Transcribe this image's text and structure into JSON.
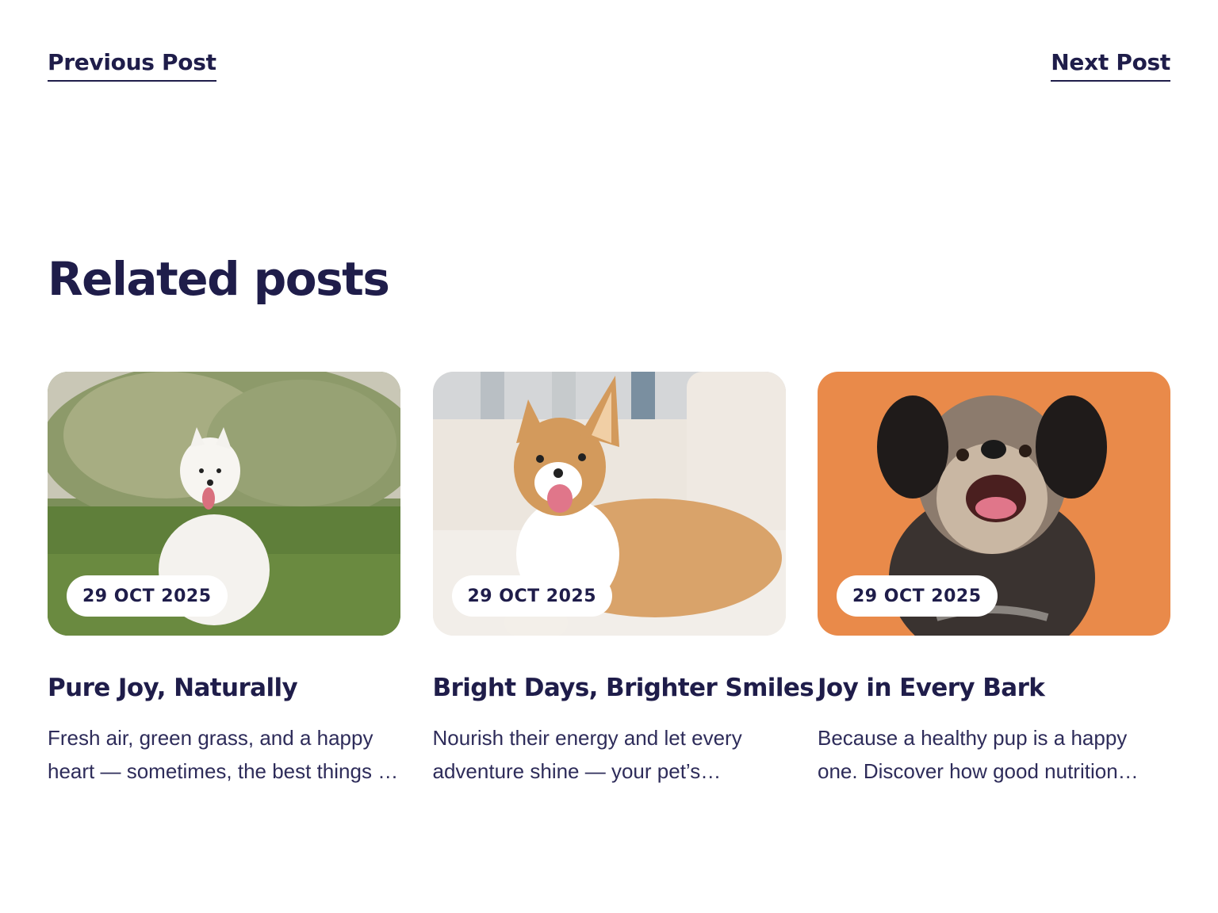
{
  "post_nav": {
    "previous_label": "Previous Post",
    "next_label": "Next Post"
  },
  "related": {
    "title": "Related posts",
    "posts": [
      {
        "date": "29 OCT 2025",
        "title": "Pure Joy, Naturally",
        "excerpt": "Fresh air, green grass, and a happy heart — sometimes, the best things in life are simple.",
        "image": "white-samoyed-puppy-on-grass"
      },
      {
        "date": "29 OCT 2025",
        "title": "Bright Days, Brighter Smiles",
        "excerpt": "Nourish their energy and let every adventure shine — your pet’s happiness starts with what’s in the bowl.",
        "image": "corgi-lying-on-sofa"
      },
      {
        "date": "29 OCT 2025",
        "title": "Joy in Every Bark",
        "excerpt": "Because a healthy pup is a happy one. Discover how good nutrition brings out the best in your dog.",
        "image": "terrier-on-orange-background"
      }
    ]
  },
  "colors": {
    "text": "#1f1d4a",
    "background": "#ffffff",
    "badge": "#ffffff"
  }
}
